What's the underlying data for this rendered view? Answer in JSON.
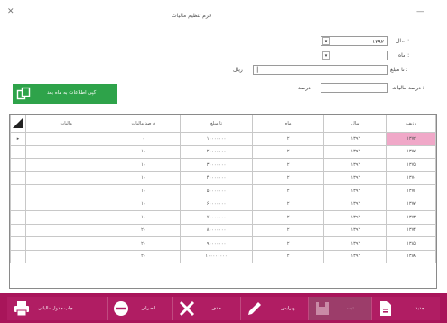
{
  "window": {
    "title": "فرم تنظیم مالیات"
  },
  "form": {
    "year_label": "سال :",
    "year_value": "۱۳۹۲",
    "month_label": "ماه :",
    "month_value": "",
    "amount_label": "تا مبلغ :",
    "amount_value": "",
    "amount_suffix": "ریال",
    "tax_label": "درصد مالیات :",
    "tax_suffix": "درصد"
  },
  "actions": {
    "copy_label": "کپی اطلاعات به ماه بعد"
  },
  "grid": {
    "columns": [
      "ردیف",
      "سال",
      "ماه",
      "تا مبلغ",
      "درصد مالیات",
      "مالیات"
    ],
    "rows": [
      [
        "۱۳۷۲",
        "۱۳۹۲",
        "۲",
        "۱۰۰۰۰۰۰۰",
        "۰",
        ""
      ],
      [
        "۱۳۷۷",
        "۱۳۹۲",
        "۲",
        "۲۰۰۰۰۰۰۰",
        "۱۰",
        ""
      ],
      [
        "۱۳۷۵",
        "۱۳۹۲",
        "۲",
        "۳۰۰۰۰۰۰۰",
        "۱۰",
        ""
      ],
      [
        "۱۳۷۰",
        "۱۳۹۲",
        "۲",
        "۴۰۰۰۰۰۰۰",
        "۱۰",
        ""
      ],
      [
        "۱۳۷۱",
        "۱۳۹۲",
        "۲",
        "۵۰۰۰۰۰۰۰",
        "۱۰",
        ""
      ],
      [
        "۱۳۷۷",
        "۱۳۹۲",
        "۲",
        "۶۰۰۰۰۰۰۰",
        "۱۰",
        ""
      ],
      [
        "۱۳۷۳",
        "۱۳۹۲",
        "۲",
        "۷۰۰۰۰۰۰۰",
        "۱۰",
        ""
      ],
      [
        "۱۳۷۴",
        "۱۳۹۲",
        "۲",
        "۸۰۰۰۰۰۰۰",
        "۲۰",
        ""
      ],
      [
        "۱۳۸۵",
        "۱۳۹۲",
        "۲",
        "۹۰۰۰۰۰۰۰",
        "۲۰",
        ""
      ],
      [
        "۱۳۸۸",
        "۱۳۹۲",
        "۲",
        "۱۰۰۰۰۰۰۰۰",
        "۲۰",
        ""
      ]
    ]
  },
  "toolbar": {
    "new_label": "جدید",
    "save_label": "ثبت",
    "edit_label": "ویرایش",
    "delete_label": "حذف",
    "cancel_label": "انصراف",
    "print_label": "چاپ جدول مالیاتی"
  },
  "colors": {
    "accent": "#a8155a",
    "green": "#2ea34a",
    "selection": "#f0a8c8"
  }
}
